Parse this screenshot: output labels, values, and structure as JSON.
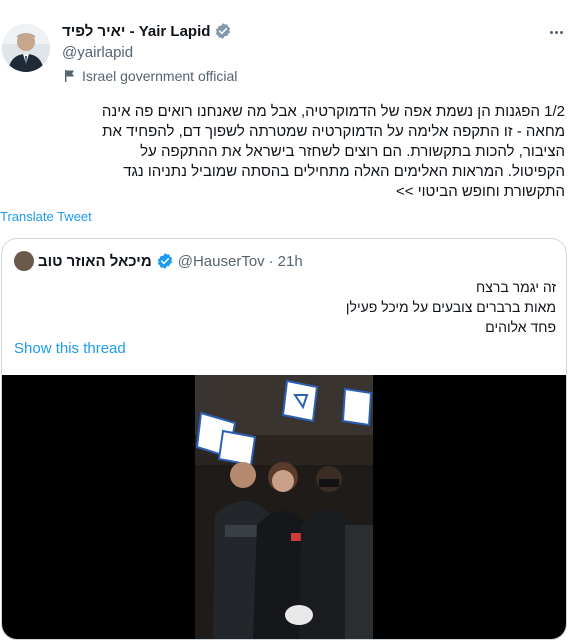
{
  "author": {
    "name": "יאיר לפיד - Yair Lapid",
    "handle": "@yairlapid",
    "label": "Israel government official"
  },
  "tweet": {
    "text": "1/2 הפגנות הן נשמת אפה של הדמוקרטיה, אבל מה שאנחנו רואים פה אינה\nמחאה - זו התקפה אלימה על הדמוקרטיה שמטרתה לשפוך דם, להפחיד את\nהציבור, להכות בתקשורת. הם רוצים לשחזר בישראל את ההתקפה על\nהקפיטול. המראות האלימים האלה מתחילים בהסתה שמוביל נתניהו נגד\nהתקשורת וחופש הביטוי >>",
    "translate_label": "Translate Tweet"
  },
  "quote": {
    "name": "מיכאל האוזר טוב",
    "handle": "@HauserTov",
    "separator": "·",
    "time": "21h",
    "text": "זה יגמר ברצח\nמאות ברברים צובעים על מיכל פעילן\nפחד אלוהים",
    "show_thread_label": "Show this thread"
  },
  "colors": {
    "link": "#1d9bf0",
    "verified": "#1d9bf0",
    "secondary_text": "#536471",
    "border": "#cfd9de"
  },
  "icons": {
    "verified": "verified-badge-icon",
    "label": "flag-icon",
    "more": "more-dots-icon"
  }
}
